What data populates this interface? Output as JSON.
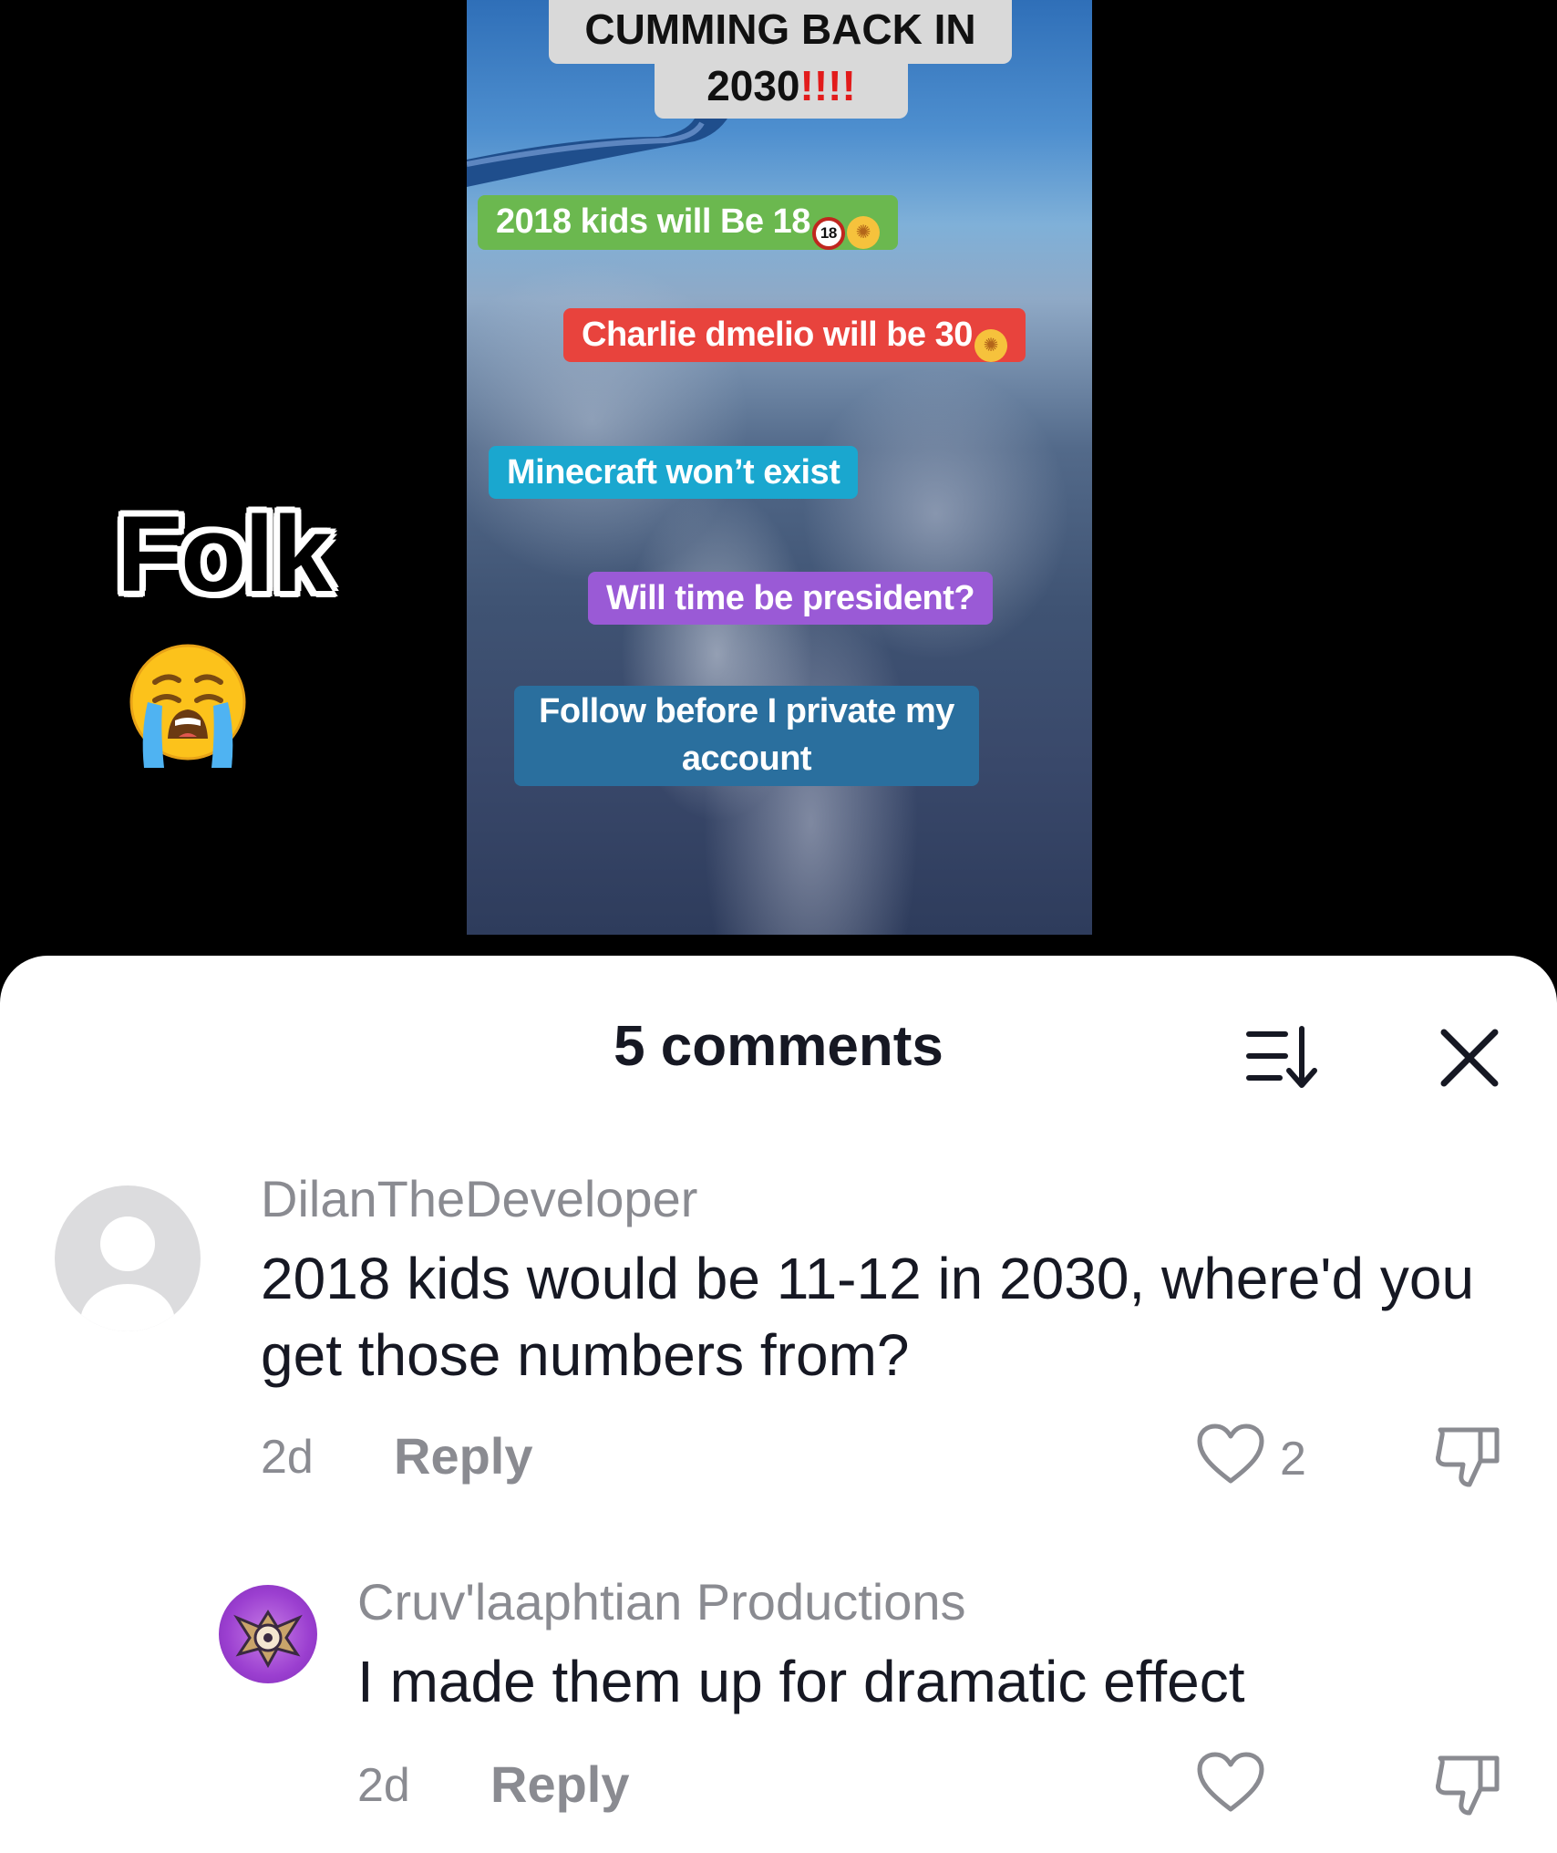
{
  "overlay": {
    "folk_text": "Folk",
    "cry_emoji": "loudly-crying-face-emoji"
  },
  "video": {
    "title_line1": "CUMMING BACK IN",
    "title_line2": "2030",
    "title_bangs": "!!!!",
    "captions": {
      "green": "2018 kids will Be 18",
      "green_badge": "18",
      "red": "Charlie dmelio will be 30",
      "cyan": "Minecraft won’t exist",
      "purple": "Will time be president?",
      "blue": "Follow before I private my account"
    }
  },
  "comments_sheet": {
    "title": "5 comments",
    "sort_icon": "sort-icon",
    "close_icon": "close-icon",
    "comments": [
      {
        "user": "DilanTheDeveloper",
        "text": "2018 kids would be 11-12 in 2030, where'd you get those numbers from?",
        "time": "2d",
        "reply_label": "Reply",
        "likes": "2"
      },
      {
        "user": "Cruv'laaphtian Productions",
        "text": "I made them up for dramatic effect",
        "time": "2d",
        "reply_label": "Reply"
      }
    ]
  }
}
